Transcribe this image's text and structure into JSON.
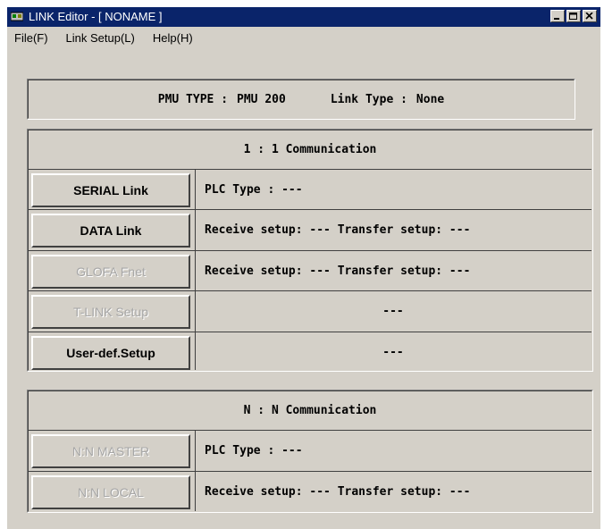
{
  "window": {
    "title": "LINK Editor - [ NONAME ]",
    "controls": [
      "minimize-icon",
      "maximize-icon",
      "close-icon"
    ]
  },
  "menu": [
    "File(F)",
    "Link Setup(L)",
    "Help(H)"
  ],
  "header": {
    "pmu_type_label": "PMU TYPE :",
    "pmu_type_value": "PMU 200",
    "link_type_label": "Link Type :",
    "link_type_value": "None"
  },
  "one_to_one": {
    "title": "1 : 1 Communication",
    "rows": [
      {
        "button": "SERIAL Link",
        "enabled": true,
        "info": "PLC Type :  ---",
        "center": false
      },
      {
        "button": "DATA Link",
        "enabled": true,
        "info": "Receive setup: ---   Transfer setup: ---",
        "center": false
      },
      {
        "button": "GLOFA Fnet",
        "enabled": false,
        "info": "Receive setup: ---   Transfer setup: ---",
        "center": false
      },
      {
        "button": "T-LINK Setup",
        "enabled": false,
        "info": "---",
        "center": true
      },
      {
        "button": "User-def.Setup",
        "enabled": true,
        "info": "---",
        "center": true
      }
    ]
  },
  "n_to_n": {
    "title": "N : N Communication",
    "rows": [
      {
        "button": "N:N MASTER",
        "enabled": false,
        "info": "PLC Type : ---",
        "center": false
      },
      {
        "button": "N:N LOCAL",
        "enabled": false,
        "info": "Receive setup: ---   Transfer setup: ---",
        "center": false
      }
    ]
  },
  "colors": {
    "titlebar": "#0a246a",
    "face": "#d4d0c8",
    "disabled_text": "#a6a6a6"
  }
}
